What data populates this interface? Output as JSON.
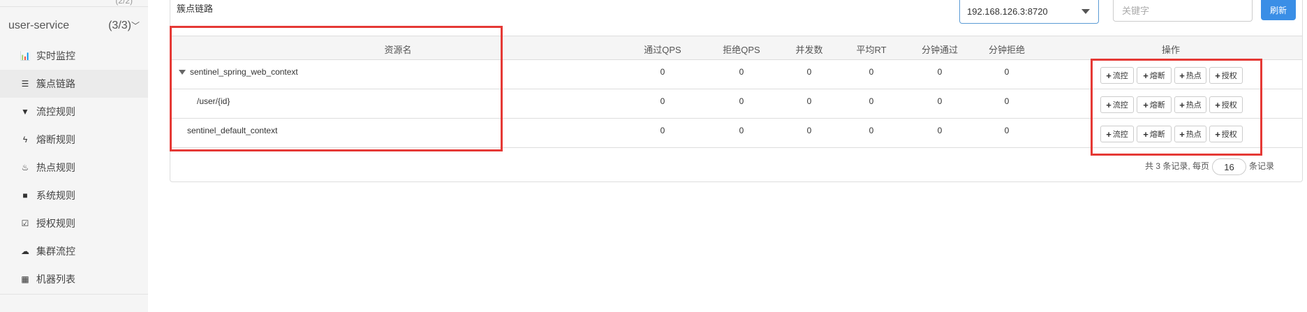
{
  "sidebar": {
    "top_stub": "(2/2)",
    "app_name": "user-service",
    "app_count": "(3/3)",
    "chevron": "﹀",
    "items": [
      {
        "label": "实时监控",
        "icon": "bar-chart-icon",
        "glyph": "📊"
      },
      {
        "label": "簇点链路",
        "icon": "list-icon",
        "glyph": "☰"
      },
      {
        "label": "流控规则",
        "icon": "filter-icon",
        "glyph": "▼"
      },
      {
        "label": "熔断规则",
        "icon": "flash-icon",
        "glyph": "ϟ"
      },
      {
        "label": "热点规则",
        "icon": "fire-icon",
        "glyph": "♨"
      },
      {
        "label": "系统规则",
        "icon": "lock-icon",
        "glyph": "■"
      },
      {
        "label": "授权规则",
        "icon": "check-icon",
        "glyph": "☑"
      },
      {
        "label": "集群流控",
        "icon": "cloud-icon",
        "glyph": "☁"
      },
      {
        "label": "机器列表",
        "icon": "th-list-icon",
        "glyph": "▦"
      }
    ]
  },
  "panel": {
    "title": "簇点链路",
    "machine_select": "192.168.126.3:8720",
    "keyword_placeholder": "关键字",
    "refresh_label": "刷新"
  },
  "table": {
    "headers": [
      "资源名",
      "通过QPS",
      "拒绝QPS",
      "并发数",
      "平均RT",
      "分钟通过",
      "分钟拒绝",
      "操作"
    ],
    "rows": [
      {
        "name": "sentinel_spring_web_context",
        "expanded": true,
        "indent": 0,
        "values": [
          "0",
          "0",
          "0",
          "0",
          "0",
          "0"
        ]
      },
      {
        "name": "/user/{id}",
        "expanded": false,
        "indent": 1,
        "values": [
          "0",
          "0",
          "0",
          "0",
          "0",
          "0"
        ]
      },
      {
        "name": "sentinel_default_context",
        "expanded": false,
        "indent": 0,
        "values": [
          "0",
          "0",
          "0",
          "0",
          "0",
          "0"
        ]
      }
    ],
    "actions": [
      "流控",
      "熔断",
      "热点",
      "授权"
    ]
  },
  "pager": {
    "prefix": "共 3 条记录, 每页",
    "page_size": "16",
    "suffix": "条记录"
  },
  "colors": {
    "accent": "#3a8ee6",
    "highlight_box": "#e53935",
    "sidebar_bg": "#f5f5f5"
  }
}
